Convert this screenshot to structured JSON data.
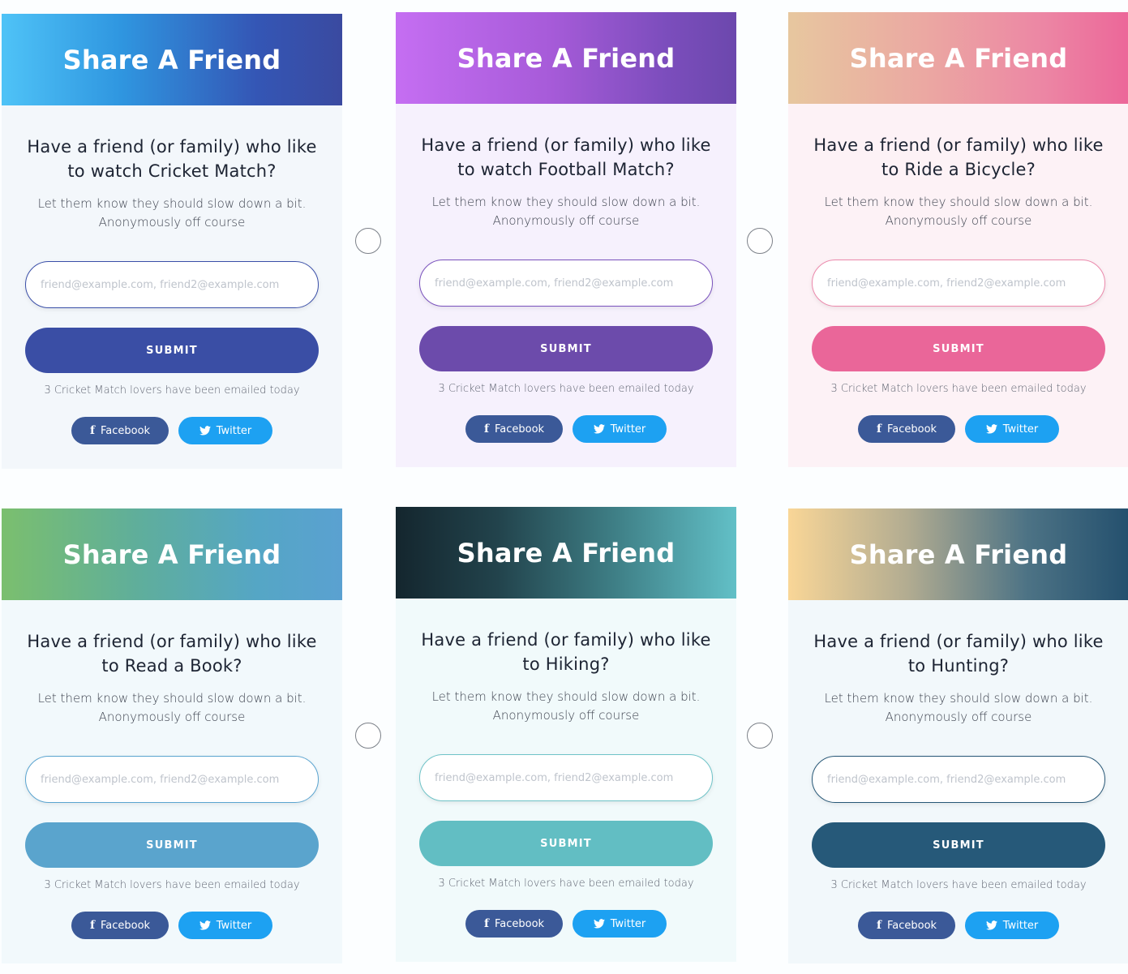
{
  "cards": [
    {
      "title": "Share A Friend",
      "question": "Have a friend (or family) who like to watch Cricket Match?",
      "description_line1": "Let them know they should slow down a bit.",
      "description_line2": "Anonymously off course",
      "email_placeholder": "friend@example.com, friend2@example.com",
      "email_value": "",
      "submit_label": "SUBMIT",
      "count_text": "3 Cricket Match lovers have been emailed today",
      "facebook_label": "Facebook",
      "twitter_label": "Twitter",
      "accent": "#3a4ea5"
    },
    {
      "title": "Share A Friend",
      "question": "Have a friend (or family) who like to watch Football Match?",
      "description_line1": "Let them know they should slow down a bit.",
      "description_line2": "Anonymously off course",
      "email_placeholder": "friend@example.com, friend2@example.com",
      "email_value": "",
      "submit_label": "SUBMIT",
      "count_text": "3 Cricket Match lovers have been emailed today",
      "facebook_label": "Facebook",
      "twitter_label": "Twitter",
      "accent": "#6c4bab"
    },
    {
      "title": "Share A Friend",
      "question": "Have a friend (or family) who like to Ride a Bicycle?",
      "description_line1": "Let them know they should slow down a bit.",
      "description_line2": "Anonymously off course",
      "email_placeholder": "friend@example.com, friend2@example.com",
      "email_value": "",
      "submit_label": "SUBMIT",
      "count_text": "3 Cricket Match lovers have been emailed today",
      "facebook_label": "Facebook",
      "twitter_label": "Twitter",
      "accent": "#ea6699"
    },
    {
      "title": "Share A Friend",
      "question": "Have a friend (or family) who like to Read a Book?",
      "description_line1": "Let them know they should slow down a bit.",
      "description_line2": "Anonymously off course",
      "email_placeholder": "friend@example.com, friend2@example.com",
      "email_value": "",
      "submit_label": "SUBMIT",
      "count_text": "3 Cricket Match lovers have been emailed today",
      "facebook_label": "Facebook",
      "twitter_label": "Twitter",
      "accent": "#5aa4cd"
    },
    {
      "title": "Share A Friend",
      "question": "Have a friend (or family) who like to Hiking?",
      "description_line1": "Let them know they should slow down a bit.",
      "description_line2": "Anonymously off course",
      "email_placeholder": "friend@example.com, friend2@example.com",
      "email_value": "",
      "submit_label": "SUBMIT",
      "count_text": "3 Cricket Match lovers have been emailed today",
      "facebook_label": "Facebook",
      "twitter_label": "Twitter",
      "accent": "#62bec3"
    },
    {
      "title": "Share A Friend",
      "question": "Have a friend (or family) who like to Hunting?",
      "description_line1": "Let them know they should slow down a bit.",
      "description_line2": "Anonymously off course",
      "email_placeholder": "friend@example.com, friend2@example.com",
      "email_value": "",
      "submit_label": "SUBMIT",
      "count_text": "3 Cricket Match lovers have been emailed today",
      "facebook_label": "Facebook",
      "twitter_label": "Twitter",
      "accent": "#265979"
    }
  ],
  "icons": {
    "facebook": "facebook-icon",
    "twitter": "twitter-icon",
    "facebook_glyph": "f"
  },
  "radios": [
    {
      "checked": false
    },
    {
      "checked": false
    },
    {
      "checked": false
    },
    {
      "checked": false
    }
  ],
  "colors": {
    "facebook": "#3b5998",
    "twitter": "#1da1f2"
  }
}
